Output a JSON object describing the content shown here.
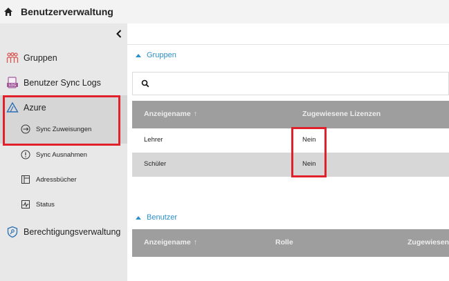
{
  "header": {
    "title": "Benutzerverwaltung",
    "icon": "home-icon"
  },
  "sidebar": {
    "collapse_icon": "chevron-left-icon",
    "items": [
      {
        "label": "Gruppen",
        "icon": "groups-icon"
      },
      {
        "label": "Benutzer Sync Logs",
        "icon": "log-icon"
      },
      {
        "label": "Azure",
        "icon": "azure-icon"
      },
      {
        "label": "Berechtigungsverwaltung",
        "icon": "shield-icon"
      }
    ],
    "sub_items": [
      {
        "label": "Sync Zuweisungen",
        "icon": "sync-icon"
      },
      {
        "label": "Sync Ausnahmen",
        "icon": "alert-circle-icon"
      },
      {
        "label": "Adressbücher",
        "icon": "address-book-icon"
      },
      {
        "label": "Status",
        "icon": "status-icon"
      }
    ]
  },
  "groups_section": {
    "title": "Gruppen",
    "search_value": "",
    "columns": [
      "Anzeigename",
      "Zugewiesene Lizenzen"
    ],
    "rows": [
      {
        "name": "Lehrer",
        "licenses": "Nein"
      },
      {
        "name": "Schüler",
        "licenses": "Nein"
      }
    ]
  },
  "users_section": {
    "title": "Benutzer",
    "columns": [
      "Anzeigename",
      "Rolle",
      "Zugewiesen"
    ]
  },
  "colors": {
    "accent": "#2b8fc9",
    "highlight": "#e0202a",
    "table_header": "#9e9e9e"
  }
}
